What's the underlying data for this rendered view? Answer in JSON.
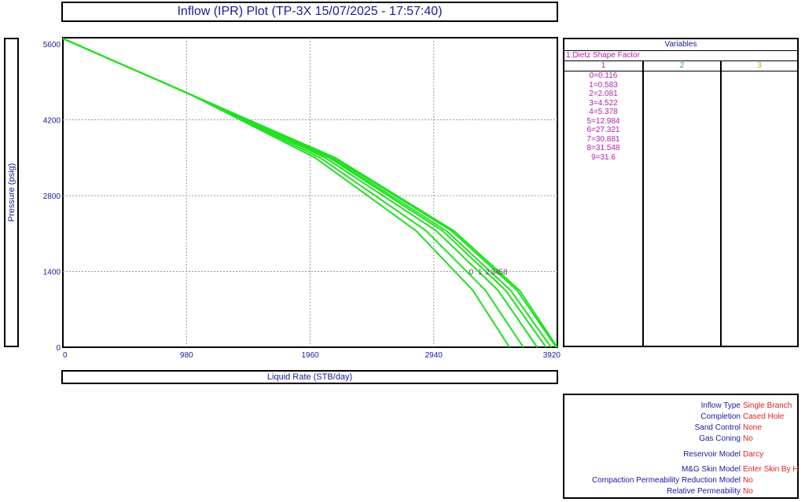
{
  "title": "Inflow (IPR) Plot (TP-3X 15/07/2025 - 17:57:40)",
  "ylabel": "Pressure  (psig)",
  "xlabel": "Liquid Rate  (STB/day)",
  "chart_data": {
    "type": "line",
    "title": "Inflow (IPR) Plot (TP-3X 15/07/2025 - 17:57:40)",
    "xlabel": "Liquid Rate  (STB/day)",
    "ylabel": "Pressure  (psig)",
    "xlim": [
      0,
      3920
    ],
    "ylim": [
      0,
      5600
    ],
    "xticks": [
      "0",
      "980",
      "1960",
      "2940",
      "3920"
    ],
    "yticks": [
      "0",
      "1400",
      "2800",
      "4200",
      "5600"
    ],
    "xtick_values": [
      0,
      980,
      1960,
      2940,
      3920
    ],
    "ytick_values": [
      0,
      1400,
      2800,
      4200,
      5600
    ],
    "grid": true,
    "color": "#22e022",
    "series": [
      {
        "label_text": "0",
        "x": [
          0,
          1000,
          2000,
          2800,
          3250,
          3540
        ],
        "y": [
          5700,
          4680,
          3500,
          2150,
          1050,
          0
        ]
      },
      {
        "label_text": "1",
        "x": [
          0,
          1000,
          2040,
          2880,
          3350,
          3650
        ],
        "y": [
          5700,
          4680,
          3500,
          2150,
          1050,
          0
        ]
      },
      {
        "label_text": "2",
        "x": [
          0,
          1000,
          2080,
          2960,
          3450,
          3760
        ],
        "y": [
          5700,
          4680,
          3500,
          2150,
          1050,
          0
        ]
      },
      {
        "label_text": "3",
        "x": [
          0,
          1000,
          2110,
          3010,
          3510,
          3830
        ],
        "y": [
          5700,
          4680,
          3500,
          2150,
          1050,
          0
        ]
      },
      {
        "label_text": "4",
        "x": [
          0,
          1000,
          2130,
          3040,
          3550,
          3870
        ],
        "y": [
          5700,
          4680,
          3500,
          2150,
          1050,
          0
        ]
      },
      {
        "label_text": "5",
        "x": [
          0,
          1000,
          2150,
          3080,
          3600,
          3910
        ],
        "y": [
          5700,
          4680,
          3500,
          2150,
          1050,
          0
        ]
      },
      {
        "label_text": "8",
        "x": [
          0,
          1000,
          2160,
          3100,
          3620,
          3920
        ],
        "y": [
          5700,
          4680,
          3500,
          2150,
          1050,
          0
        ]
      }
    ],
    "curve_labels": [
      {
        "text": "0",
        "x": 3220,
        "y": 1400
      },
      {
        "text": "1",
        "x": 3290,
        "y": 1400
      },
      {
        "text": "2",
        "x": 3350,
        "y": 1400
      },
      {
        "text": "3",
        "x": 3390,
        "y": 1400
      },
      {
        "text": "4",
        "x": 3425,
        "y": 1400
      },
      {
        "text": "5",
        "x": 3455,
        "y": 1400
      },
      {
        "text": "8",
        "x": 3490,
        "y": 1400
      }
    ]
  },
  "variables": {
    "title": "Variables",
    "subtitle": "1:Dietz Shape Factor",
    "columns": [
      {
        "label": "1",
        "color": "#b020b0"
      },
      {
        "label": "2",
        "color": "#20a0a0"
      },
      {
        "label": "3",
        "color": "#d0a020"
      }
    ],
    "items": [
      "0=0.116",
      "1=0.583",
      "2=2.081",
      "3=4.522",
      "4=5.378",
      "5=12.984",
      "6=27.321",
      "7=30.881",
      "8=31.548",
      "9=31.6"
    ]
  },
  "info": [
    {
      "label": "Inflow Type",
      "value": "Single Branch"
    },
    {
      "label": "Completion",
      "value": "Cased Hole"
    },
    {
      "label": "Sand Control",
      "value": "None"
    },
    {
      "label": "Gas Coning",
      "value": "No"
    },
    {
      "label": "Reservoir Model",
      "value": "Darcy"
    },
    {
      "label": "M&G Skin Model",
      "value": "Enter Skin By H"
    },
    {
      "label": "Compaction Permeability Reduction Model",
      "value": "No"
    },
    {
      "label": "Relative Permeability",
      "value": "No"
    }
  ]
}
